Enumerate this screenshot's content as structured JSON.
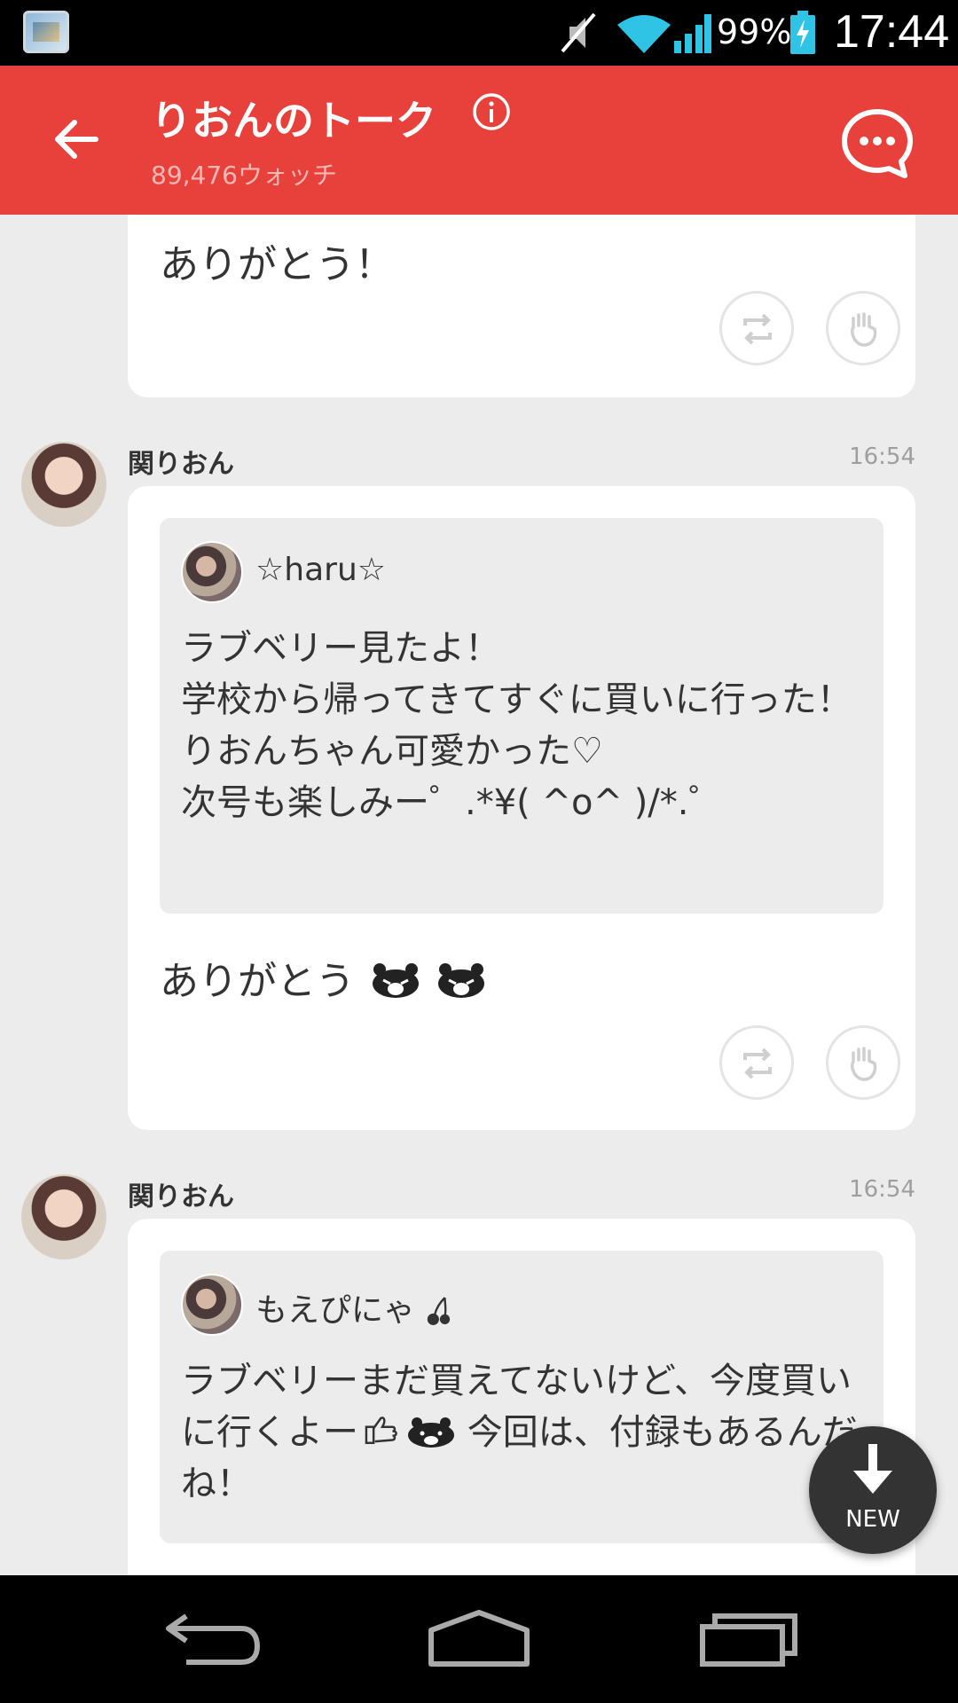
{
  "status_bar": {
    "battery_percent": "99%",
    "time": "17:44",
    "icons": [
      "gallery-thumbnail-icon",
      "mute-icon",
      "wifi-icon",
      "signal-icon",
      "battery-charging-icon"
    ]
  },
  "header": {
    "title": "りおんのトーク",
    "watch_count": "89,476ウォッチ",
    "icons": [
      "back-arrow-icon",
      "info-icon",
      "chat-bubble-icon"
    ],
    "accent_color": "#e8413b"
  },
  "messages": [
    {
      "text": "ありがとう！",
      "actions": [
        "repost-icon",
        "clap-icon"
      ]
    },
    {
      "sender": "関りおん",
      "time": "16:54",
      "quote": {
        "name": "☆haru☆",
        "text": "ラブベリー見たよ！\n学校から帰ってきてすぐに買いに行った！\nりおんちゃん可愛かった♡\n次号も楽しみー゜.*¥( ^o^ )/*.゜"
      },
      "reply": "ありがとう",
      "reply_emojis": [
        "bear-emoji-icon",
        "bear-emoji-icon"
      ],
      "actions": [
        "repost-icon",
        "clap-icon"
      ]
    },
    {
      "sender": "関りおん",
      "time": "16:54",
      "quote": {
        "name": "もえぴにゃ",
        "name_emoji": "cherry-icon",
        "text_part1": "ラブベリーまだ買えてないけど、今度買いに行くよー",
        "text_emojis": [
          "thumbs-up-icon",
          "bear-emoji-icon"
        ],
        "text_part2": " 今回は、付録もあるんだね！"
      }
    }
  ],
  "fab": {
    "label": "NEW",
    "icon": "arrow-down-icon"
  },
  "nav_bar": {
    "icons": [
      "nav-back-icon",
      "nav-home-icon",
      "nav-recents-icon"
    ]
  }
}
